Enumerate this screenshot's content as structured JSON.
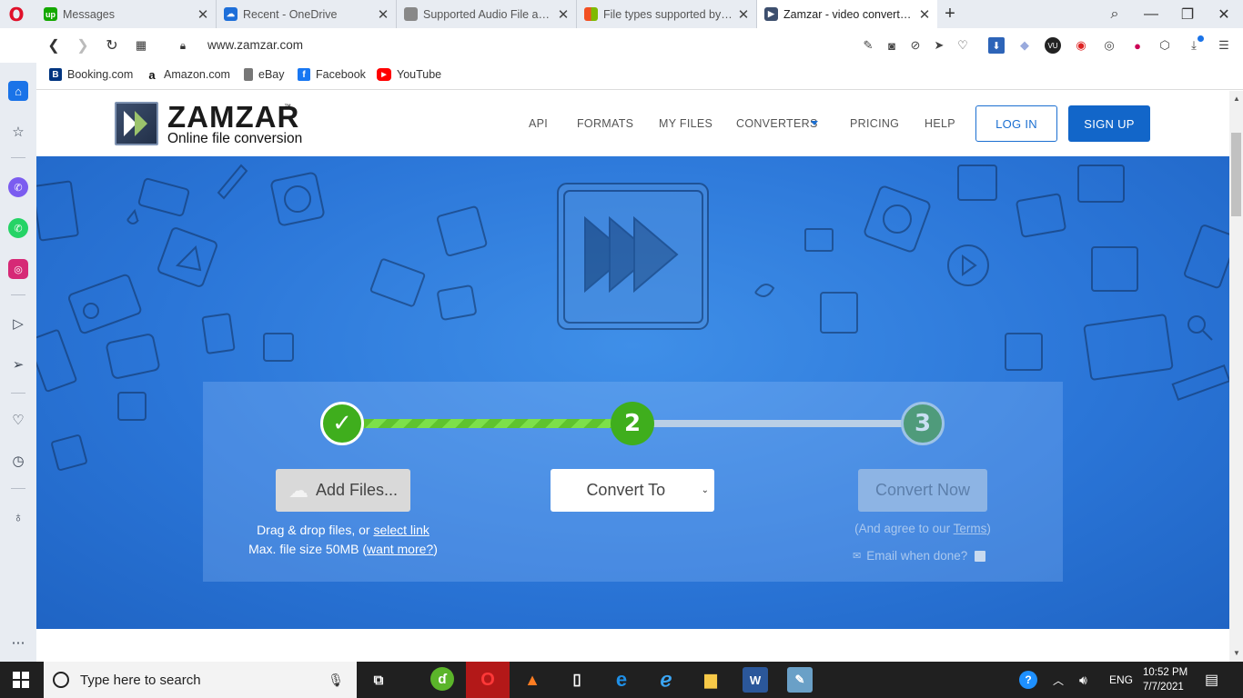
{
  "browser": {
    "tabs": [
      {
        "title": "Messages",
        "favicon": "upwork-icon",
        "color": "#14a800",
        "active": false
      },
      {
        "title": "Recent - OneDrive",
        "favicon": "onedrive-icon",
        "color": "#1e6fd9",
        "active": false
      },
      {
        "title": "Supported Audio File and D",
        "favicon": "apple-icon",
        "color": "#888888",
        "active": false
      },
      {
        "title": "File types supported by Wi",
        "favicon": "microsoft-icon",
        "color": "#f25022",
        "active": false
      },
      {
        "title": "Zamzar - video converter, a",
        "favicon": "zamzar-icon",
        "color": "#3d4f6e",
        "active": true
      }
    ],
    "url": "www.zamzar.com",
    "bookmarks": [
      {
        "label": "Booking.com",
        "icon": "booking-icon",
        "color": "#003580",
        "glyph": "B"
      },
      {
        "label": "Amazon.com",
        "icon": "amazon-icon",
        "color": "#ffffff",
        "glyph": "a"
      },
      {
        "label": "eBay",
        "icon": "page-icon",
        "color": "#ffffff",
        "glyph": ""
      },
      {
        "label": "Facebook",
        "icon": "facebook-icon",
        "color": "#1877f2",
        "glyph": "f"
      },
      {
        "label": "YouTube",
        "icon": "youtube-icon",
        "color": "#ff0000",
        "glyph": "▶"
      }
    ]
  },
  "site": {
    "logo": {
      "name": "ZAMZAR",
      "tm": "™",
      "tagline": "Online file conversion"
    },
    "nav": [
      "API",
      "FORMATS",
      "MY FILES",
      "CONVERTERS",
      "PRICING",
      "HELP"
    ],
    "login": "LOG IN",
    "signup": "SIGN UP",
    "accent": "#1266c9",
    "converter": {
      "steps": [
        {
          "label": "✓",
          "state": "done",
          "color": "#3fae1d"
        },
        {
          "label": "2",
          "state": "current",
          "color": "#3fae1d"
        },
        {
          "label": "3",
          "state": "pending",
          "color": "#4f9b7b"
        }
      ],
      "add_files": "Add Files...",
      "drag_text": "Drag & drop files, or",
      "select_link": "select link",
      "max_size": "Max. file size 50MB (",
      "want_more": "want more?",
      "max_size_end": ")",
      "convert_to": "Convert To",
      "convert_now": "Convert Now",
      "agree_text": "(And agree to our",
      "terms": "Terms",
      "agree_end": ")",
      "email_when_done": "Email when done?"
    }
  },
  "taskbar": {
    "search_placeholder": "Type here to search",
    "language": "ENG",
    "time": "10:52 PM",
    "date": "7/7/2021"
  }
}
